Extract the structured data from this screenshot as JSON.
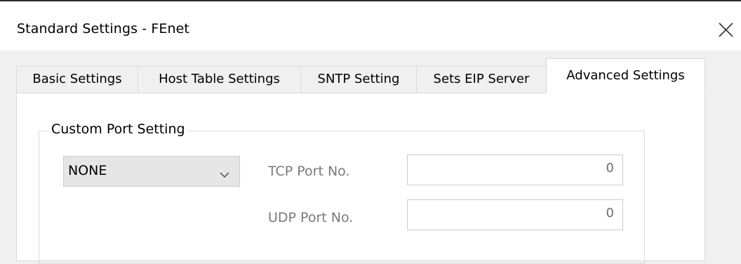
{
  "window": {
    "title": "Standard Settings - FEnet",
    "close_icon": "close-icon"
  },
  "tabs": [
    {
      "label": "Basic Settings",
      "active": false
    },
    {
      "label": "Host Table Settings",
      "active": false
    },
    {
      "label": "SNTP Setting",
      "active": false
    },
    {
      "label": "Sets EIP Server",
      "active": false
    },
    {
      "label": "Advanced Settings",
      "active": true
    }
  ],
  "custom_port": {
    "group_title": "Custom Port Setting",
    "mode": {
      "selected": "NONE",
      "icon": "chevron-down-icon"
    },
    "tcp": {
      "label": "TCP Port No.",
      "value": "0"
    },
    "udp": {
      "label": "UDP Port No.",
      "value": "0"
    }
  }
}
